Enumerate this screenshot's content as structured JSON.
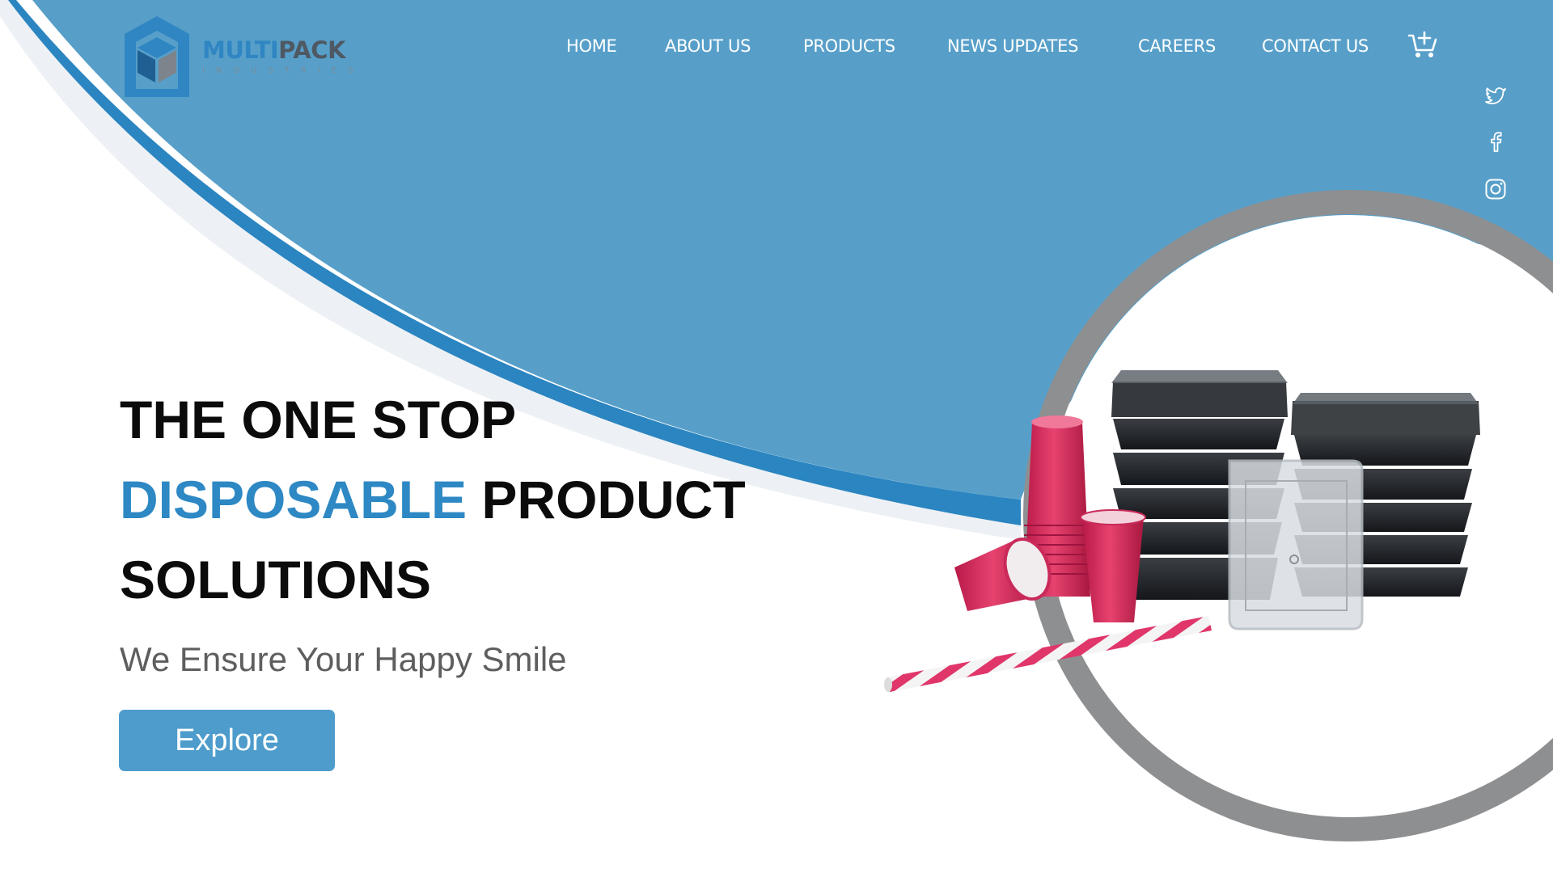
{
  "brand": {
    "name_part1": "MULTI",
    "name_part2": "PACK",
    "sub": "INDUSTRIES"
  },
  "nav": {
    "items": [
      {
        "label": "HOME"
      },
      {
        "label": "ABOUT US"
      },
      {
        "label": "PRODUCTS"
      },
      {
        "label": "NEWS UPDATES"
      },
      {
        "label": "CAREERS"
      },
      {
        "label": "CONTACT US"
      }
    ]
  },
  "icons": {
    "cart": "cart-add-icon",
    "social": [
      "twitter-icon",
      "facebook-icon",
      "instagram-icon"
    ]
  },
  "hero": {
    "line1": "THE ONE STOP",
    "accent_word": "DISPOSABLE",
    "line2_rest": " PRODUCT",
    "line3": "SOLUTIONS",
    "subtitle": "We Ensure Your Happy Smile",
    "cta_label": "Explore"
  },
  "colors": {
    "sky_blue": "#579fc9",
    "deep_blue": "#2b85c1",
    "accent_text": "#2d88c4",
    "button": "#4d9ccc",
    "ring_gray": "#8e8f91",
    "cup_red": "#d8285a"
  }
}
